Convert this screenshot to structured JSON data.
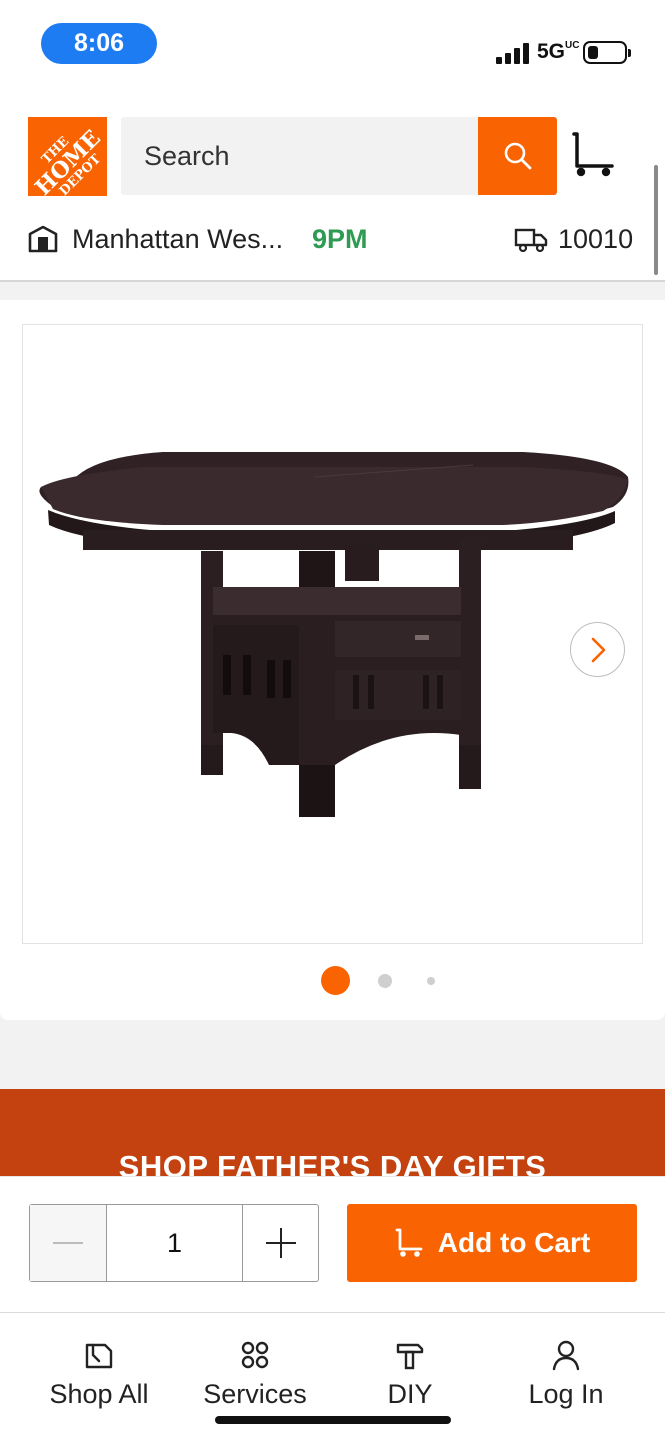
{
  "status_bar": {
    "time": "8:06",
    "network": "5G",
    "network_sup": "UC"
  },
  "header": {
    "logo_line1": "THE",
    "logo_line2": "HOME",
    "logo_line3": "DEPOT",
    "search_placeholder": "Search"
  },
  "store": {
    "name": "Manhattan Wes...",
    "hours": "9PM",
    "zip": "10010"
  },
  "gallery": {
    "total_images": 3,
    "active_index": 1
  },
  "promo": {
    "text": "SHOP FATHER'S DAY GIFTS"
  },
  "purchase": {
    "quantity": "1",
    "add_to_cart_label": "Add to Cart"
  },
  "bottom_nav": {
    "items": [
      {
        "label": "Shop All",
        "icon": "shop-all-icon"
      },
      {
        "label": "Services",
        "icon": "services-icon"
      },
      {
        "label": "DIY",
        "icon": "diy-icon"
      },
      {
        "label": "Log In",
        "icon": "account-icon"
      }
    ]
  },
  "colors": {
    "brand_orange": "#f96302",
    "hours_green": "#2e9a52",
    "time_pill_blue": "#1e7cf2",
    "promo_red": "#c4420f"
  }
}
